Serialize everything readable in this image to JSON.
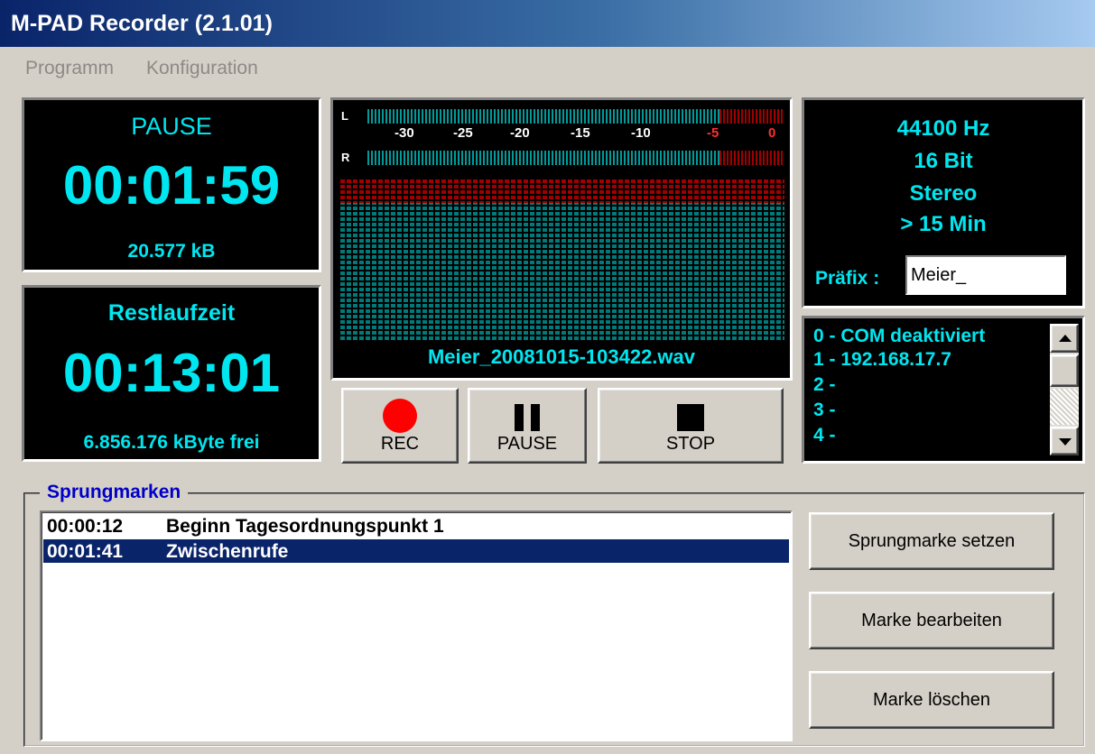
{
  "window": {
    "title": "M-PAD Recorder (2.1.01)"
  },
  "menu": {
    "items": [
      "Programm",
      "Konfiguration"
    ]
  },
  "status": {
    "state": "PAUSE",
    "time": "00:01:59",
    "size": "20.577 kB"
  },
  "remaining": {
    "label": "Restlaufzeit",
    "time": "00:13:01",
    "free": "6.856.176 kByte frei"
  },
  "meter": {
    "channel_left": "L",
    "channel_right": "R",
    "scale": [
      "-30",
      "-25",
      "-20",
      "-15",
      "-10",
      "-5",
      "0"
    ],
    "filename": "Meier_20081015-103422.wav",
    "colors": {
      "bar": "#009a9a",
      "peak": "#c00000",
      "scale_peak": "#ff3030"
    }
  },
  "transport": {
    "rec_label": "REC",
    "pause_label": "PAUSE",
    "stop_label": "STOP",
    "icons": [
      "record-icon",
      "pause-icon",
      "stop-icon"
    ],
    "rec_color": "#ff0000"
  },
  "format": {
    "rate": "44100 Hz",
    "bits": "16 Bit",
    "channels": "Stereo",
    "duration": "> 15 Min",
    "prefix_label": "Präfix :",
    "prefix_value": "Meier_"
  },
  "com": {
    "items": [
      "0 - COM deaktiviert",
      "1 - 192.168.17.7",
      "2 -",
      "3 -",
      "4 -"
    ]
  },
  "marks": {
    "group_label": "Sprungmarken",
    "rows": [
      {
        "time": "00:00:12",
        "text": "Beginn Tagesordnungspunkt 1",
        "selected": false
      },
      {
        "time": "00:01:41",
        "text": "Zwischenrufe",
        "selected": true
      }
    ],
    "set_button": "Sprungmarke setzen",
    "edit_button": "Marke bearbeiten",
    "delete_button": "Marke löschen"
  },
  "accent": {
    "title_gradient_start": "#0a246a",
    "selection": "#0a246a",
    "group_label": "#0000c8",
    "display_text": "#00e6f0"
  }
}
